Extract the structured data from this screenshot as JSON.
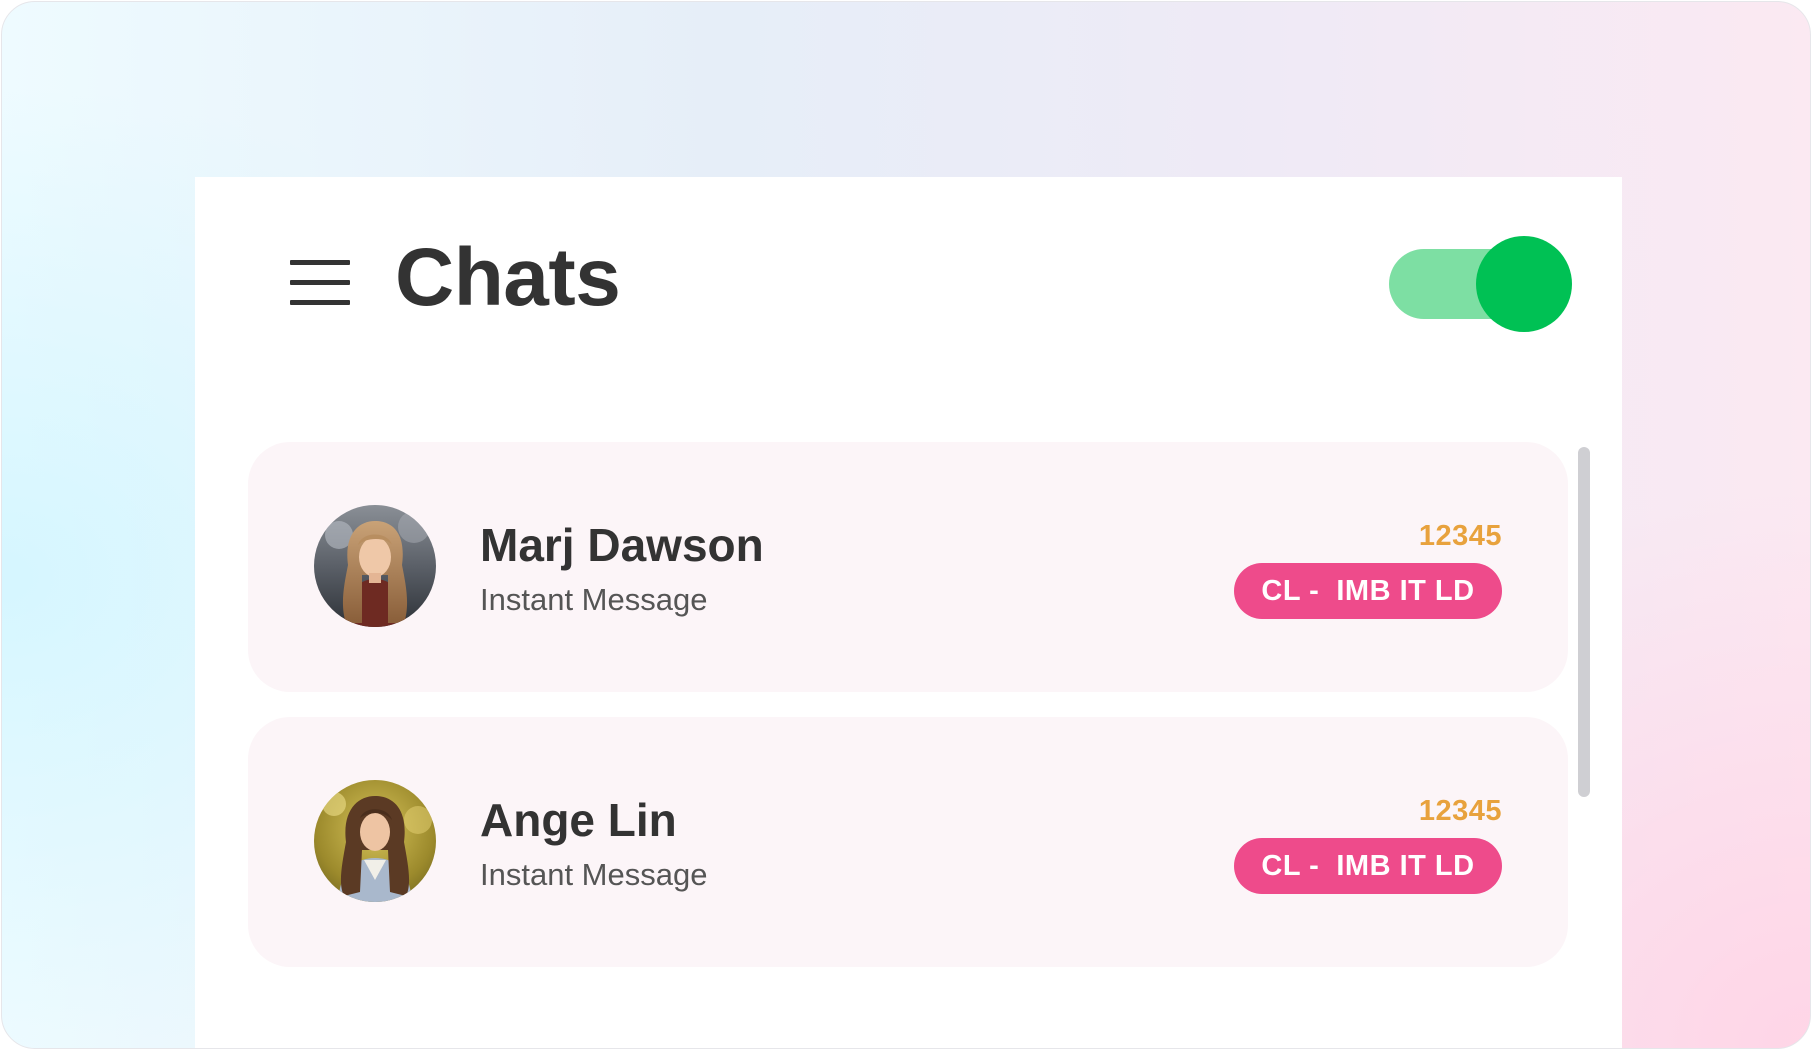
{
  "header": {
    "title": "Chats",
    "menu_icon": "hamburger-menu-icon",
    "toggle": {
      "state": "on",
      "track_color": "#7ddfa3",
      "knob_color": "#00c154"
    }
  },
  "chats": [
    {
      "name": "Marj Dawson",
      "subtitle": "Instant Message",
      "number": "12345",
      "badge": "CL -  IMB IT LD",
      "avatar": "avatar-photo-woman-blonde-hair"
    },
    {
      "name": "Ange Lin",
      "subtitle": "Instant Message",
      "number": "12345",
      "badge": "CL -  IMB IT LD",
      "avatar": "avatar-photo-woman-brown-hair"
    }
  ],
  "colors": {
    "title_text": "#333333",
    "number_text": "#e8a23d",
    "badge_bg": "#ee4b8b",
    "card_bg": "#fcf5f8",
    "toggle_on": "#00c154"
  }
}
